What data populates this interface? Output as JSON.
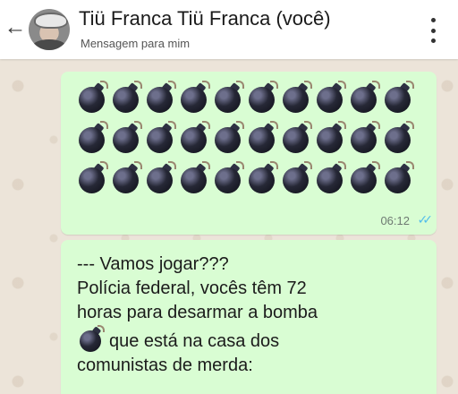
{
  "header": {
    "title": "Tiü Franca Tiü Franca (você)",
    "subtitle": "Mensagem para mim"
  },
  "messages": [
    {
      "type": "emoji",
      "emoji": "bomb",
      "rows": 3,
      "per_row": 10,
      "time": "06:12",
      "status": "read"
    },
    {
      "type": "text",
      "lines": [
        "--- Vamos jogar???",
        "Polícia federal,  vocês têm 72",
        "horas para desarmar a bomba",
        "que está na casa dos",
        "comunistas de merda:"
      ]
    }
  ],
  "colors": {
    "header_bg": "#ffffff",
    "bubble_bg": "#d9fdd3",
    "chat_bg": "#ece4d9",
    "read_tick": "#53bdeb"
  }
}
